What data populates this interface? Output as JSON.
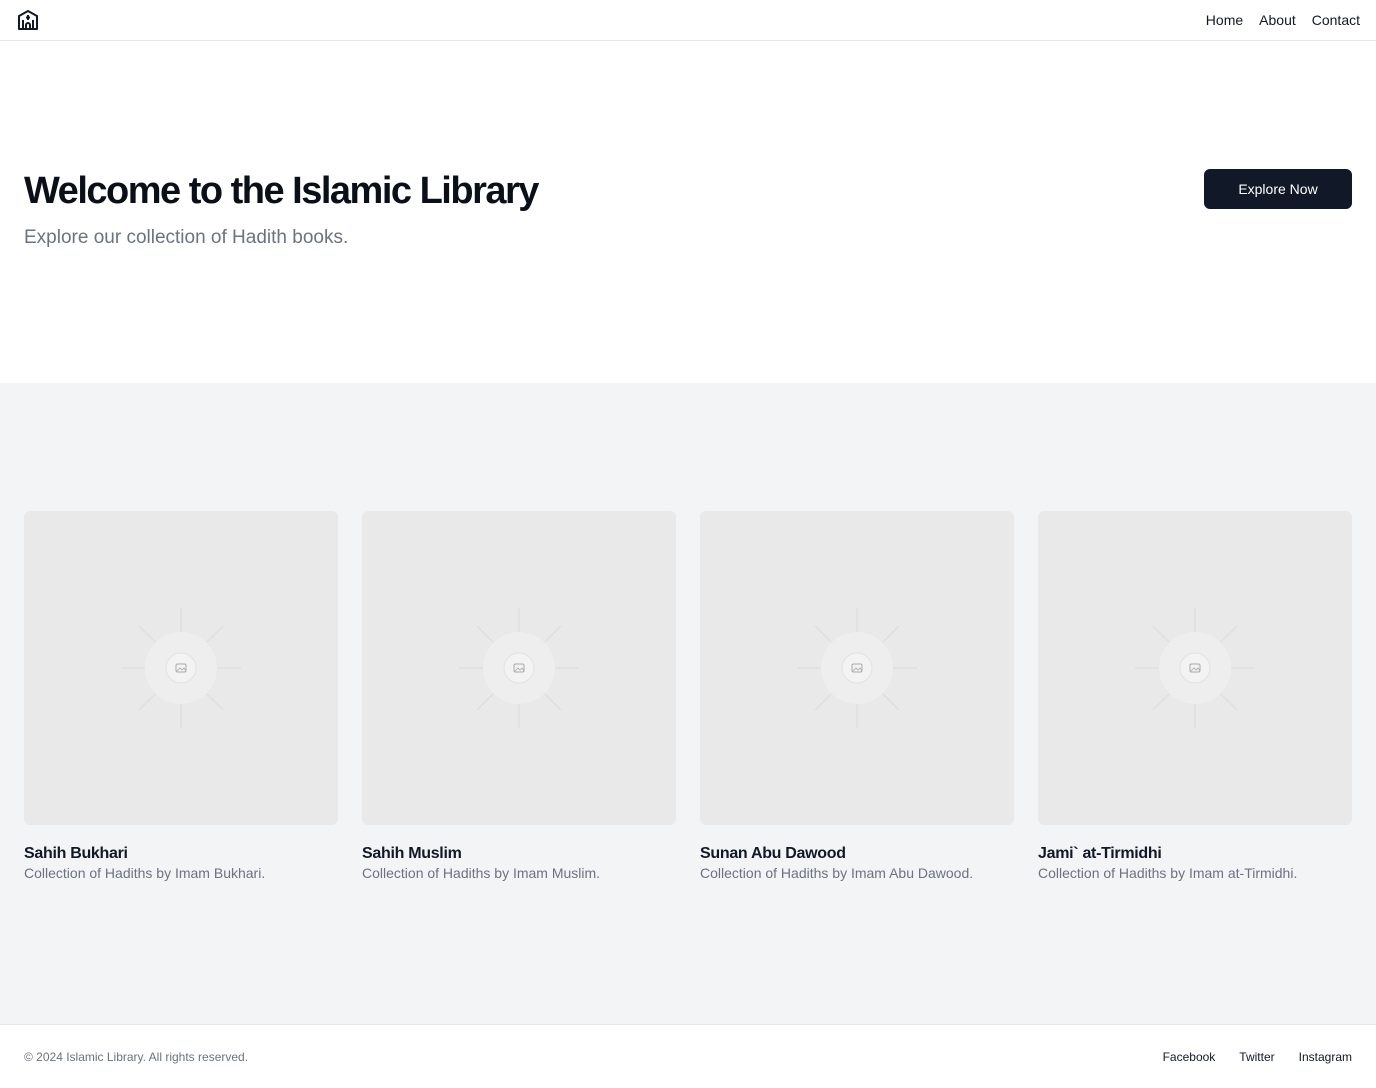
{
  "header": {
    "logo_icon": "library-building-icon",
    "nav": [
      {
        "label": "Home"
      },
      {
        "label": "About"
      },
      {
        "label": "Contact"
      }
    ]
  },
  "hero": {
    "title": "Welcome to the Islamic Library",
    "subtitle": "Explore our collection of Hadith books.",
    "cta_label": "Explore Now"
  },
  "books": [
    {
      "title": "Sahih Bukhari",
      "description": "Collection of Hadiths by Imam Bukhari.",
      "image_icon": "image-placeholder-icon"
    },
    {
      "title": "Sahih Muslim",
      "description": "Collection of Hadiths by Imam Muslim.",
      "image_icon": "image-placeholder-icon"
    },
    {
      "title": "Sunan Abu Dawood",
      "description": "Collection of Hadiths by Imam Abu Dawood.",
      "image_icon": "image-placeholder-icon"
    },
    {
      "title": "Jami` at-Tirmidhi",
      "description": "Collection of Hadiths by Imam at-Tirmidhi.",
      "image_icon": "image-placeholder-icon"
    }
  ],
  "footer": {
    "copyright": "© 2024 Islamic Library. All rights reserved.",
    "social": [
      {
        "label": "Facebook"
      },
      {
        "label": "Twitter"
      },
      {
        "label": "Instagram"
      }
    ]
  },
  "colors": {
    "primary": "#111827",
    "muted_text": "#6b7280",
    "section_bg": "#f3f4f6",
    "placeholder_bg": "#e9e9e9",
    "border": "#e5e7eb"
  }
}
